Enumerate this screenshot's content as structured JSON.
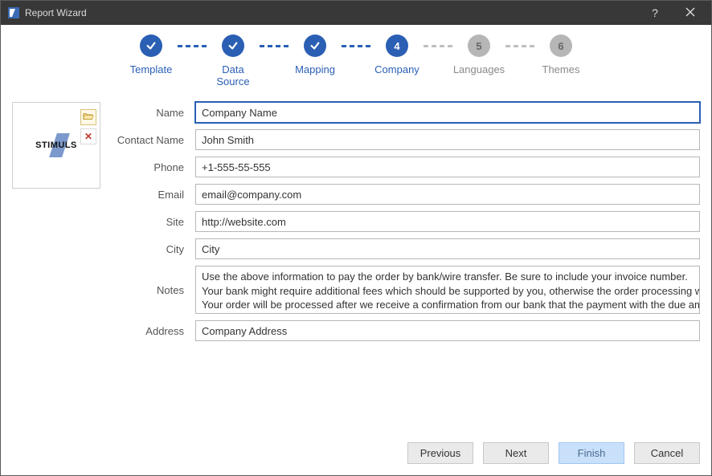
{
  "titlebar": {
    "title": "Report Wizard",
    "help_aria": "Help",
    "close_aria": "Close"
  },
  "stepper": [
    {
      "label": "Template",
      "state": "done",
      "content": "check"
    },
    {
      "label": "Data Source",
      "state": "done",
      "content": "check"
    },
    {
      "label": "Mapping",
      "state": "done",
      "content": "check"
    },
    {
      "label": "Company",
      "state": "active",
      "content": "4"
    },
    {
      "label": "Languages",
      "state": "future",
      "content": "5"
    },
    {
      "label": "Themes",
      "state": "future",
      "content": "6"
    }
  ],
  "preview": {
    "logo_text": "STIMULS",
    "open_aria": "Open logo file",
    "delete_aria": "Remove logo"
  },
  "form": {
    "labels": {
      "name": "Name",
      "contact_name": "Contact Name",
      "phone": "Phone",
      "email": "Email",
      "site": "Site",
      "city": "City",
      "notes": "Notes",
      "address": "Address"
    },
    "values": {
      "name": "Company Name",
      "contact_name": "John Smith",
      "phone": "+1-555-55-555",
      "email": "email@company.com",
      "site": "http://website.com",
      "city": "City",
      "notes": "Use the above information to pay the order by bank/wire transfer. Be sure to include your invoice number.\nYour bank might require additional fees which should be supported by you, otherwise the order processing will be delayed.\nYour order will be processed after we receive a confirmation from our bank that the payment with the due amount has arrived.",
      "address": "Company Address"
    }
  },
  "footer": {
    "previous": "Previous",
    "next": "Next",
    "finish": "Finish",
    "cancel": "Cancel"
  }
}
